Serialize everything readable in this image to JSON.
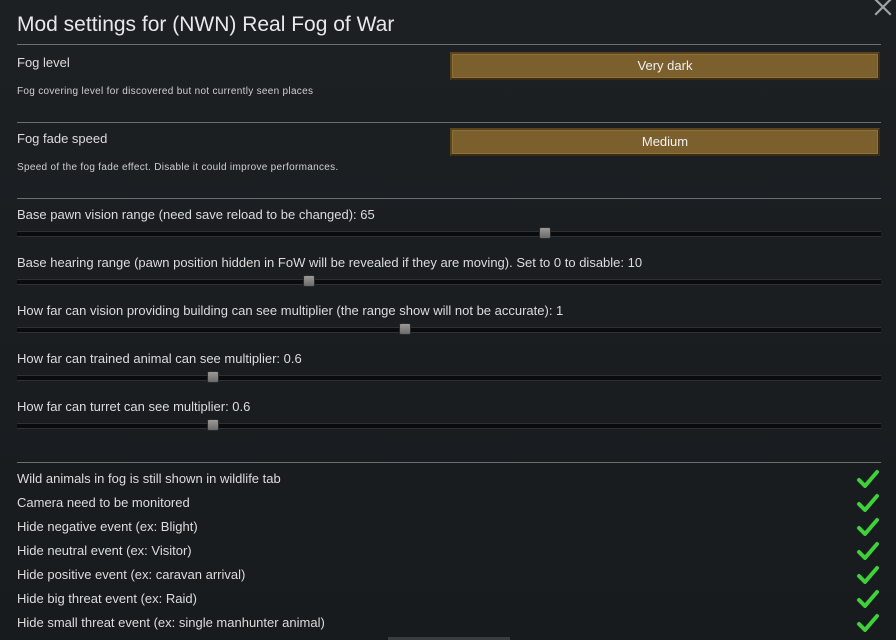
{
  "window": {
    "title": "Mod settings for (NWN) Real Fog of War"
  },
  "icons": {
    "close": "close-icon",
    "check": "checkmark-icon"
  },
  "colors": {
    "dropdown_bg": "#7b5f2d",
    "check_green": "#3ed13a",
    "background": "#1c2023"
  },
  "fog_level": {
    "label": "Fog level",
    "description": "Fog covering level for discovered but not currently seen places",
    "value": "Very dark"
  },
  "fog_fade": {
    "label": "Fog fade speed",
    "description": "Speed of the fog fade effect. Disable it could improve performances.",
    "value": "Medium"
  },
  "sliders": [
    {
      "label": "Base pawn vision range (need save reload to be changed): 65",
      "fraction": 0.61
    },
    {
      "label": "Base hearing range (pawn position hidden in FoW will be revealed if they are moving). Set to 0 to disable: 10",
      "fraction": 0.337
    },
    {
      "label": "How far can vision providing building can see multiplier (the range show will not be accurate): 1",
      "fraction": 0.448
    },
    {
      "label": "How far can trained animal can see multiplier: 0.6",
      "fraction": 0.226
    },
    {
      "label": "How far can turret can see multiplier: 0.6",
      "fraction": 0.226
    }
  ],
  "toggles": [
    {
      "label": "Wild animals in fog is still shown in wildlife tab",
      "checked": true
    },
    {
      "label": "Camera need to be monitored",
      "checked": true
    },
    {
      "label": "Hide negative event (ex: Blight)",
      "checked": true
    },
    {
      "label": "Hide neutral event (ex: Visitor)",
      "checked": true
    },
    {
      "label": "Hide positive event (ex: caravan arrival)",
      "checked": true
    },
    {
      "label": "Hide big threat event (ex: Raid)",
      "checked": true
    },
    {
      "label": "Hide small threat event (ex: single manhunter animal)",
      "checked": true
    }
  ]
}
